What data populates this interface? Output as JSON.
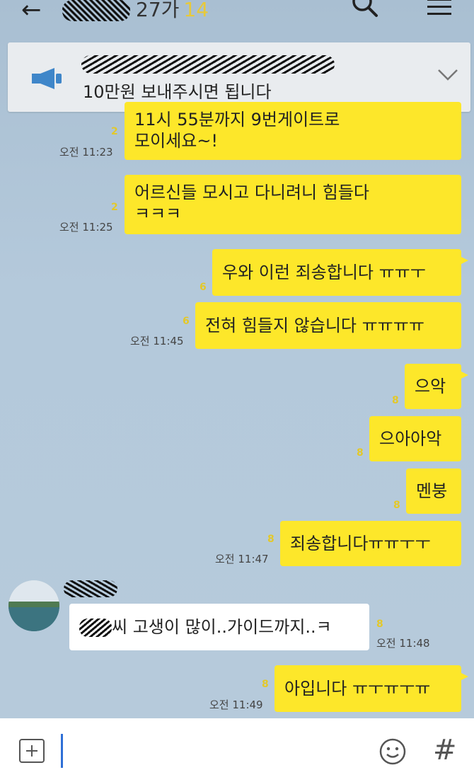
{
  "header": {
    "back_glyph": "←",
    "member_count": "27",
    "member_suffix": "가",
    "unread": "14"
  },
  "notice": {
    "text": "10만원 보내주시면 됩니다"
  },
  "messages": [
    {
      "text_line1": "11시 55분까지 9번게이트로",
      "text_line2": "모이세요~!",
      "read": "2",
      "time": "오전 11:23"
    },
    {
      "text_line1": "어르신들 모시고 다니려니 힘들다",
      "text_line2": "ㅋㅋㅋ",
      "read": "2",
      "time": "오전 11:25"
    },
    {
      "text": "우와 이런 죄송합니다 ㅠㅠㅜ",
      "read": "6"
    },
    {
      "text": "전혀 힘들지 않습니다 ㅠㅠㅠㅠ",
      "read": "6",
      "time": "오전 11:45"
    },
    {
      "text": "으악",
      "read": "8"
    },
    {
      "text": "으아아악",
      "read": "8"
    },
    {
      "text": "멘붕",
      "read": "8"
    },
    {
      "text": "죄송합니다ㅠㅠㅜㅜ",
      "read": "8",
      "time": "오전 11:47"
    },
    {
      "text_after_name": "씨 고생이 많이..가이드까지..ㅋ",
      "read": "8",
      "time": "오전 11:48"
    },
    {
      "text": "아입니다 ㅠㅜㅠㅜㅠ",
      "read": "8",
      "time": "오전 11:49"
    }
  ],
  "input": {
    "hash_glyph": "#"
  },
  "colors": {
    "bubble_yellow": "#fde72a",
    "chat_bg": "#b2c7d9",
    "read_count": "#e3c82a"
  }
}
